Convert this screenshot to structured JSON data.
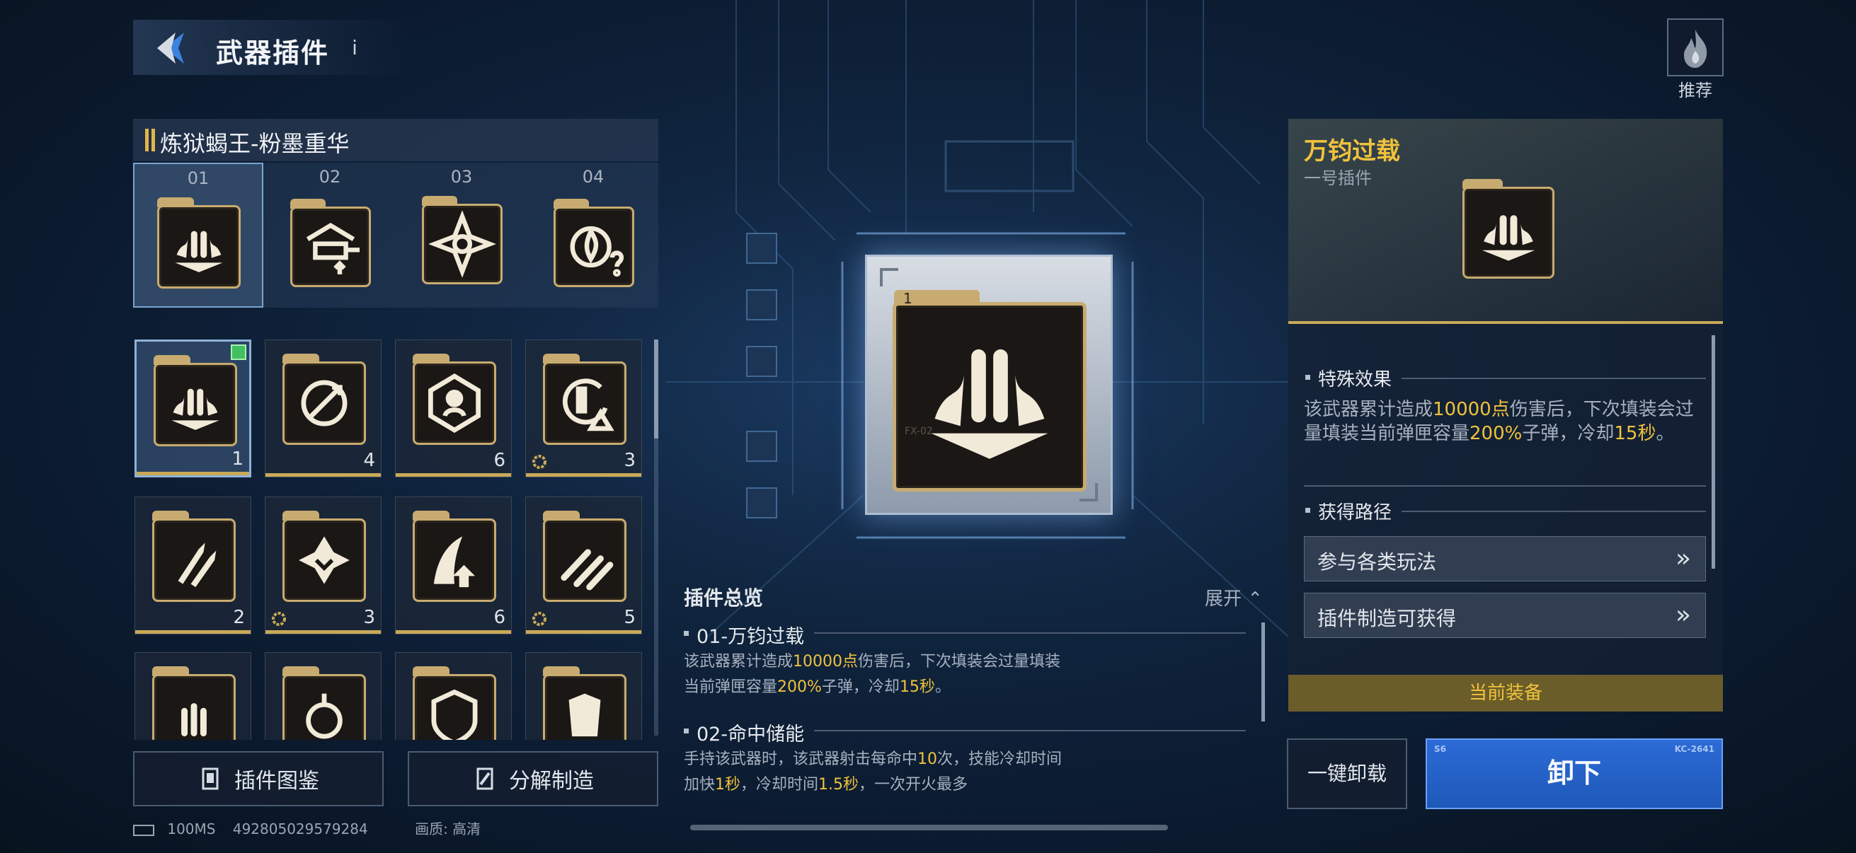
{
  "header": {
    "title": "武器插件",
    "info_icon": "i",
    "recommend_label": "推荐"
  },
  "weapon": {
    "name": "炼狱蝎王-粉墨重华"
  },
  "slots": [
    {
      "num": "01",
      "icon": "bullets-wings-icon"
    },
    {
      "num": "02",
      "icon": "turret-icon"
    },
    {
      "num": "03",
      "icon": "crosshair-star-icon"
    },
    {
      "num": "04",
      "icon": "fire-question-icon"
    }
  ],
  "inventory": [
    {
      "count": "1",
      "icon": "bullets-wings-icon",
      "equipped": true
    },
    {
      "count": "4",
      "icon": "rocket-circle-icon"
    },
    {
      "count": "6",
      "icon": "target-head-icon"
    },
    {
      "count": "3",
      "icon": "reload-warning-icon",
      "gear": true
    },
    {
      "count": "2",
      "icon": "rockets-icon"
    },
    {
      "count": "3",
      "icon": "burst-icon",
      "gear": true
    },
    {
      "count": "6",
      "icon": "wave-up-icon"
    },
    {
      "count": "5",
      "icon": "missiles-icon",
      "gear": true
    },
    {
      "count": "",
      "icon": "bullets-icon"
    },
    {
      "count": "",
      "icon": "grenade-icon"
    },
    {
      "count": "",
      "icon": "shield-icon"
    },
    {
      "count": "",
      "icon": "armor-icon"
    }
  ],
  "buttons": {
    "catalog": "插件图鉴",
    "craft": "分解制造",
    "unload_all": "一键卸载",
    "unload": "卸下"
  },
  "status": {
    "ping": "100MS",
    "id": "492805029579284",
    "quality": "画质: 高清"
  },
  "overview": {
    "title": "插件总览",
    "expand": "展开",
    "items": [
      {
        "heading": "01-万钧过载",
        "parts": [
          "该武器累计造成",
          "10000点",
          "伤害后，下次填装会过量填装当前弹匣容量",
          "200%",
          "子弹，冷却",
          "15秒",
          "。"
        ]
      },
      {
        "heading": "02-命中储能",
        "parts": [
          "手持该武器时，该武器射击每命中",
          "10",
          "次，技能冷却时间加快",
          "1秒",
          "，冷却时间",
          "1.5秒",
          "，一次开火最多"
        ]
      }
    ]
  },
  "detail": {
    "name": "万钧过载",
    "sub": "一号插件",
    "effect_title": "特殊效果",
    "effect_parts": [
      "该武器累计造成",
      "10000点",
      "伤害后，下次填装会过量填装当前弹匣容量",
      "200%",
      "子弹，冷却",
      "15秒",
      "。"
    ],
    "source_title": "获得路径",
    "sources": [
      "参与各类玩法",
      "插件制造可获得"
    ],
    "current": "当前装备"
  },
  "chip_marks": {
    "num": "1",
    "code": "FX-02"
  },
  "unload_marks": {
    "left": "S6",
    "right": "KC-2641"
  },
  "colors": {
    "accent_gold": "#c9a957",
    "highlight": "#f0c23c",
    "primary_blue": "#2c6bd6"
  }
}
